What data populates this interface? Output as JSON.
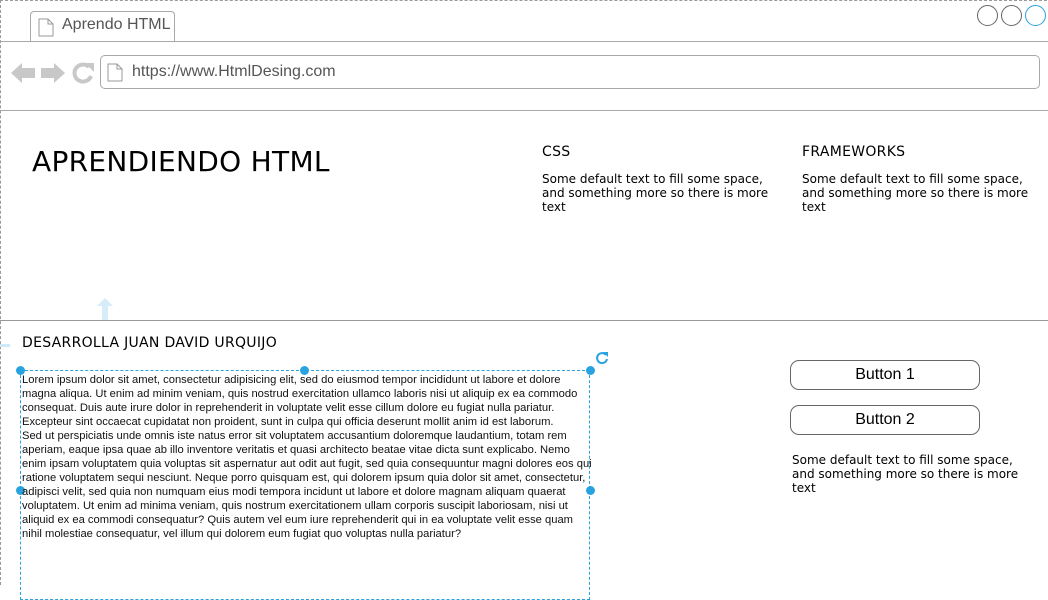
{
  "browser": {
    "tab_title": "Aprendo HTML",
    "url": "https://www.HtmlDesing.com",
    "icons": {
      "back": "back-arrow-icon",
      "forward": "forward-arrow-icon",
      "reload": "reload-icon",
      "page": "page-icon"
    }
  },
  "header": {
    "title": "APRENDIENDO HTML",
    "columns": [
      {
        "heading": "CSS",
        "text": "Some default text to fill some space, and something more so there is more text"
      },
      {
        "heading": "FRAMEWORKS",
        "text": "Some default text to fill some space, and something more so there is more text"
      }
    ]
  },
  "main": {
    "author": "DESARROLLA JUAN DAVID URQUIJO",
    "paragraphs": [
      "Lorem ipsum dolor sit amet, consectetur adipisicing elit, sed do eiusmod tempor incididunt ut labore et dolore magna aliqua. Ut enim ad minim veniam, quis nostrud exercitation ullamco laboris nisi ut aliquip ex ea commodo consequat. Duis aute irure dolor in reprehenderit in voluptate velit esse cillum dolore eu fugiat nulla pariatur. Excepteur sint occaecat cupidatat non proident, sunt in culpa qui officia deserunt mollit anim id est laborum.",
      "Sed ut perspiciatis unde omnis iste natus error sit voluptatem accusantium doloremque laudantium, totam rem aperiam, eaque ipsa quae ab illo inventore veritatis et quasi architecto beatae vitae dicta sunt explicabo. Nemo enim ipsam voluptatem quia voluptas sit aspernatur aut odit aut fugit, sed quia consequuntur magni dolores eos qui ratione voluptatem sequi nesciunt. Neque porro quisquam est, qui dolorem ipsum quia dolor sit amet, consectetur, adipisci velit, sed quia non numquam eius modi tempora incidunt ut labore et dolore magnam aliquam quaerat voluptatem. Ut enim ad minima veniam, quis nostrum exercitationem ullam corporis suscipit laboriosam, nisi ut aliquid ex ea commodi consequatur? Quis autem vel eum iure reprehenderit qui in ea voluptate velit esse quam nihil molestiae consequatur, vel illum qui dolorem eum fugiat quo voluptas nulla pariatur?"
    ]
  },
  "sidebar": {
    "button1": "Button 1",
    "button2": "Button 2",
    "text": "Some default text to fill some space, and something more so there is more text"
  },
  "colors": {
    "selection": "#29a3e0",
    "border": "#a8a8a8",
    "nav_icon": "#c8c8c8"
  }
}
